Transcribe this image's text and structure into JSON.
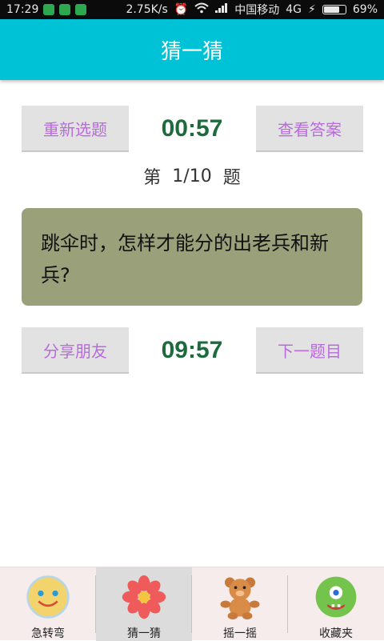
{
  "status_bar": {
    "time": "17:29",
    "speed": "2.75K/s",
    "carrier": "中国移动",
    "network": "4G",
    "battery": "69%",
    "battery_level": 0.69
  },
  "header": {
    "title": "猜一猜"
  },
  "controls_top": {
    "reselect_label": "重新选题",
    "timer": "00:57",
    "answer_label": "查看答案"
  },
  "progress": {
    "prefix": "第",
    "value": "1/10",
    "suffix": "题"
  },
  "question": {
    "text": "跳伞时，怎样才能分的出老兵和新兵?"
  },
  "controls_bottom": {
    "share_label": "分享朋友",
    "timer": "09:57",
    "next_label": "下一题目"
  },
  "tabs": [
    {
      "label": "急转弯",
      "icon": "smiley-icon"
    },
    {
      "label": "猜一猜",
      "icon": "flower-icon"
    },
    {
      "label": "摇一摇",
      "icon": "teddy-bear-icon"
    },
    {
      "label": "收藏夹",
      "icon": "green-monster-icon"
    }
  ],
  "colors": {
    "header": "#00c2d6",
    "button_text": "#b86bdc",
    "timer": "#1d6b3d",
    "question_bg": "#9aa17a"
  }
}
